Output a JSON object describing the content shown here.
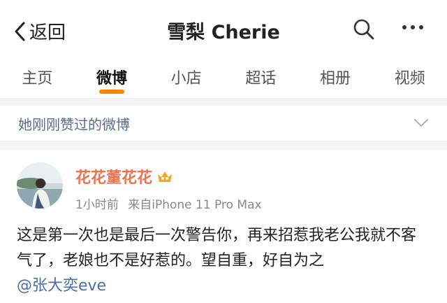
{
  "header": {
    "back_label": "返回",
    "title": "雪梨 Cherie"
  },
  "tabs": [
    {
      "label": "主页"
    },
    {
      "label": "微博"
    },
    {
      "label": "小店"
    },
    {
      "label": "超话"
    },
    {
      "label": "相册"
    },
    {
      "label": "视频"
    }
  ],
  "active_tab": "微博",
  "liked_section": {
    "label": "她刚刚赞过的微博"
  },
  "post": {
    "author": "花花董花花",
    "time": "1小时前",
    "source": "来自iPhone 11 Pro Max",
    "text": "这是第一次也是最后一次警告你，再来招惹我老公我就不客气了，老娘也不是好惹的。望自重，好自为之",
    "mention": "@张大奕eve"
  },
  "colors": {
    "accent": "#ff8200",
    "author_name": "#eb7350",
    "link": "#4a6ea9",
    "section_label": "#5b6b88"
  },
  "icons": [
    "chevron-left-icon",
    "search-icon",
    "more-icon",
    "chevron-down-icon",
    "vip-badge-icon"
  ]
}
